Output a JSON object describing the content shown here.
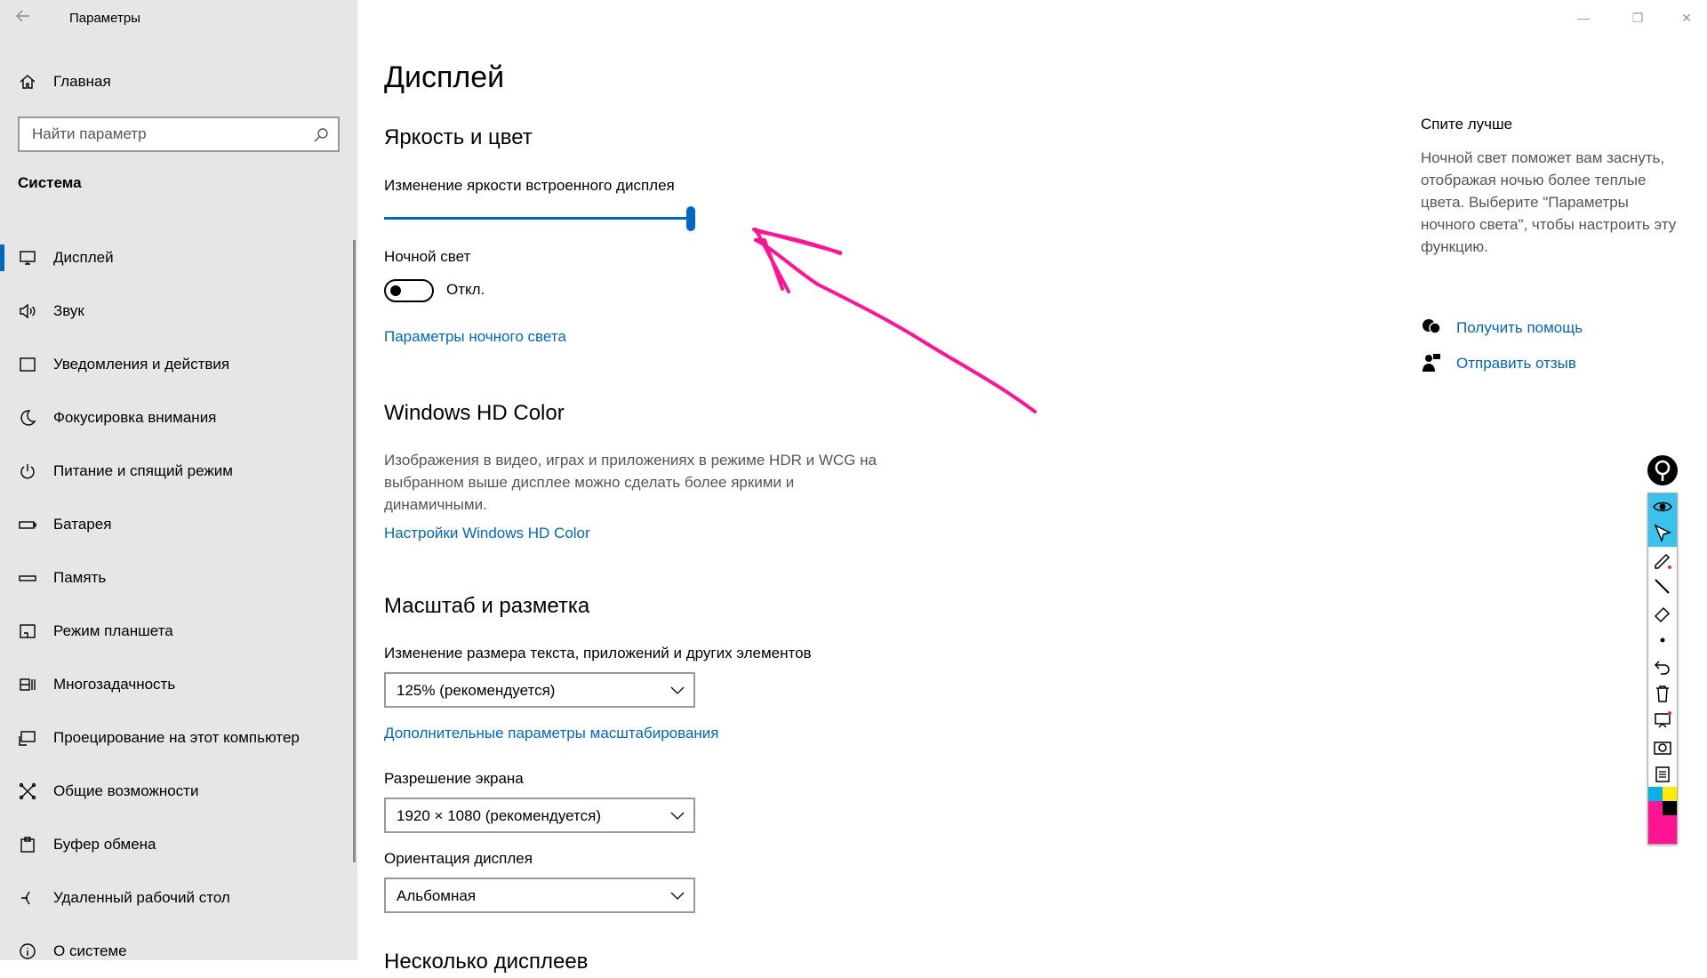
{
  "window": {
    "title": "Параметры",
    "controls": {
      "minimize": "—",
      "maximize": "❐",
      "close": "✕"
    }
  },
  "sidebar": {
    "home_label": "Главная",
    "search_placeholder": "Найти параметр",
    "section_label": "Система",
    "items": [
      {
        "label": "Дисплей",
        "icon": "monitor-icon",
        "active": true
      },
      {
        "label": "Звук",
        "icon": "speaker-icon",
        "active": false
      },
      {
        "label": "Уведомления и действия",
        "icon": "notification-icon",
        "active": false
      },
      {
        "label": "Фокусировка внимания",
        "icon": "moon-icon",
        "active": false
      },
      {
        "label": "Питание и спящий режим",
        "icon": "power-icon",
        "active": false
      },
      {
        "label": "Батарея",
        "icon": "battery-icon",
        "active": false
      },
      {
        "label": "Память",
        "icon": "storage-icon",
        "active": false
      },
      {
        "label": "Режим планшета",
        "icon": "tablet-icon",
        "active": false
      },
      {
        "label": "Многозадачность",
        "icon": "multitask-icon",
        "active": false
      },
      {
        "label": "Проецирование на этот компьютер",
        "icon": "project-icon",
        "active": false
      },
      {
        "label": "Общие возможности",
        "icon": "shared-icon",
        "active": false
      },
      {
        "label": "Буфер обмена",
        "icon": "clipboard-icon",
        "active": false
      },
      {
        "label": "Удаленный рабочий стол",
        "icon": "remote-desktop-icon",
        "active": false
      },
      {
        "label": "О системе",
        "icon": "info-icon",
        "active": false
      }
    ]
  },
  "main": {
    "page_title": "Дисплей",
    "brightness": {
      "heading": "Яркость и цвет",
      "slider_label": "Изменение яркости встроенного дисплея",
      "slider_value": 1.0
    },
    "night_light": {
      "label": "Ночной свет",
      "toggle_state": "Откл.",
      "link": "Параметры ночного света"
    },
    "hd_color": {
      "heading": "Windows HD Color",
      "description": "Изображения в видео, играх и приложениях в режиме HDR и WCG на выбранном выше дисплее можно сделать более яркими и динамичными.",
      "link": "Настройки Windows HD Color"
    },
    "scale": {
      "heading": "Масштаб и разметка",
      "size_label": "Изменение размера текста, приложений и других элементов",
      "size_value": "125% (рекомендуется)",
      "advanced_link": "Дополнительные параметры масштабирования",
      "resolution_label": "Разрешение экрана",
      "resolution_value": "1920 × 1080 (рекомендуется)",
      "orientation_label": "Ориентация дисплея",
      "orientation_value": "Альбомная"
    },
    "next_heading": "Несколько дисплеев"
  },
  "aside": {
    "title": "Спите лучше",
    "description": "Ночной свет поможет вам заснуть, отображая ночью более теплые цвета. Выберите \"Параметры ночного света\", чтобы настроить эту функцию.",
    "help_link": "Получить помощь",
    "feedback_link": "Отправить отзыв"
  },
  "annotation": {
    "arrow_color": "#ff1493"
  },
  "colors": {
    "accent": "#0067c0",
    "sidebar_bg": "#e6e6e6",
    "toolbar_selected": "#39c2ec"
  }
}
